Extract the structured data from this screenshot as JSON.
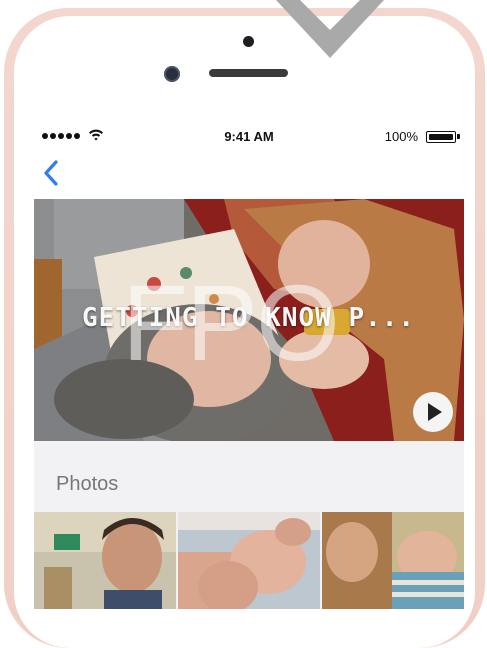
{
  "status_bar": {
    "time": "9:41 AM",
    "battery_percent": "100%"
  },
  "hero": {
    "title": "GETTING TO KNOW P...",
    "placeholder_overlay": "FPO"
  },
  "photos_section": {
    "label": "Photos"
  },
  "icons": {
    "back": "chevron-left-icon",
    "play": "play-icon",
    "wifi": "wifi-icon",
    "battery": "battery-icon"
  },
  "colors": {
    "accent": "#2f7df6",
    "phone_frame": "#f0d0c6",
    "section_background": "#f2f2f4"
  }
}
